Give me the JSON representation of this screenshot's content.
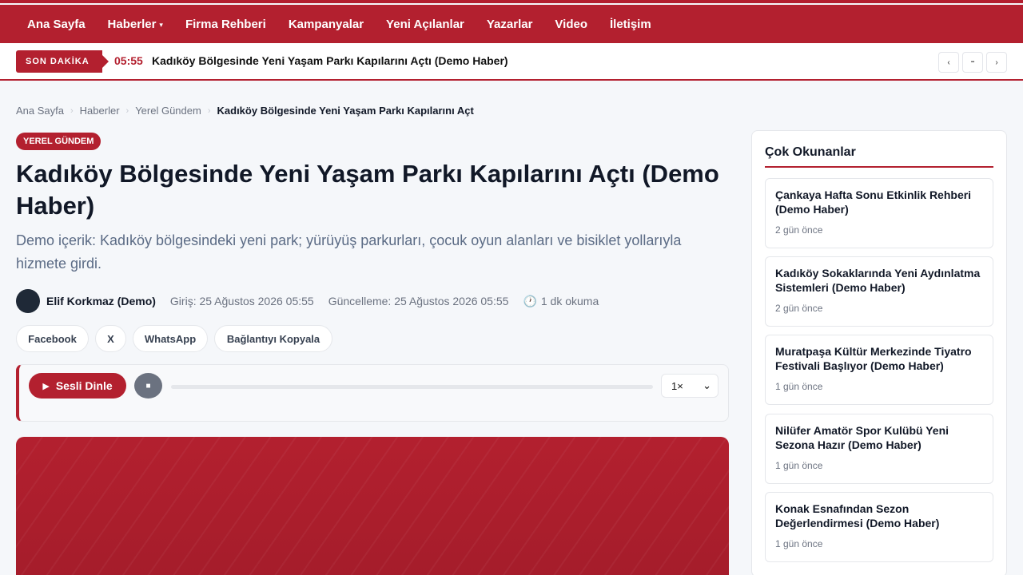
{
  "nav": {
    "items": [
      "Ana Sayfa",
      "Haberler",
      "Firma Rehberi",
      "Kampanyalar",
      "Yeni Açılanlar",
      "Yazarlar",
      "Video",
      "İletişim"
    ],
    "caret": "▾"
  },
  "ticker": {
    "label": "SON DAKİKA",
    "time": "05:55",
    "headline": "Kadıköy Bölgesinde Yeni Yaşam Parkı Kapılarını Açtı (Demo Haber)",
    "prev": "‹",
    "pause": "▪▪",
    "next": "›"
  },
  "breadcrumb": [
    "Ana Sayfa",
    "Haberler",
    "Yerel Gündem",
    "Kadıköy Bölgesinde Yeni Yaşam Parkı Kapılarını Açt"
  ],
  "breadcrumb_sep": "›",
  "article": {
    "category": "YEREL GÜNDEM",
    "title": "Kadıköy Bölgesinde Yeni Yaşam Parkı Kapılarını Açtı (Demo Haber)",
    "summary": "Demo içerik: Kadıköy bölgesindeki yeni park; yürüyüş parkurları, çocuk oyun alanları ve bisiklet yollarıyla hizmete girdi.",
    "author": "Elif Korkmaz (Demo)",
    "published": "Giriş: 25 Ağustos 2026 05:55",
    "updated": "Güncelleme: 25 Ağustos 2026 05:55",
    "read_time": "1 dk okuma",
    "clock": "🕐"
  },
  "share": [
    "Facebook",
    "X",
    "WhatsApp",
    "Bağlantıyı Kopyala"
  ],
  "player": {
    "listen_label": "Sesli Dinle",
    "play_glyph": "▶",
    "stop_glyph": "■",
    "speed": "1×",
    "speed_caret": "⌄",
    "progress": 0
  },
  "sidebar": {
    "title": "Çok Okunanlar",
    "items": [
      {
        "title": "Çankaya Hafta Sonu Etkinlik Rehberi (Demo Haber)",
        "date": "2 gün önce"
      },
      {
        "title": "Kadıköy Sokaklarında Yeni Aydınlatma Sistemleri (Demo Haber)",
        "date": "2 gün önce"
      },
      {
        "title": "Muratpaşa Kültür Merkezinde Tiyatro Festivali Başlıyor (Demo Haber)",
        "date": "1 gün önce"
      },
      {
        "title": "Nilüfer Amatör Spor Kulübü Yeni Sezona Hazır (Demo Haber)",
        "date": "1 gün önce"
      },
      {
        "title": "Konak Esnafından Sezon Değerlendirmesi (Demo Haber)",
        "date": "1 gün önce"
      }
    ]
  },
  "colors": {
    "brand": "#b3202f",
    "muted": "#6b7280",
    "summary": "#5b6b85"
  }
}
